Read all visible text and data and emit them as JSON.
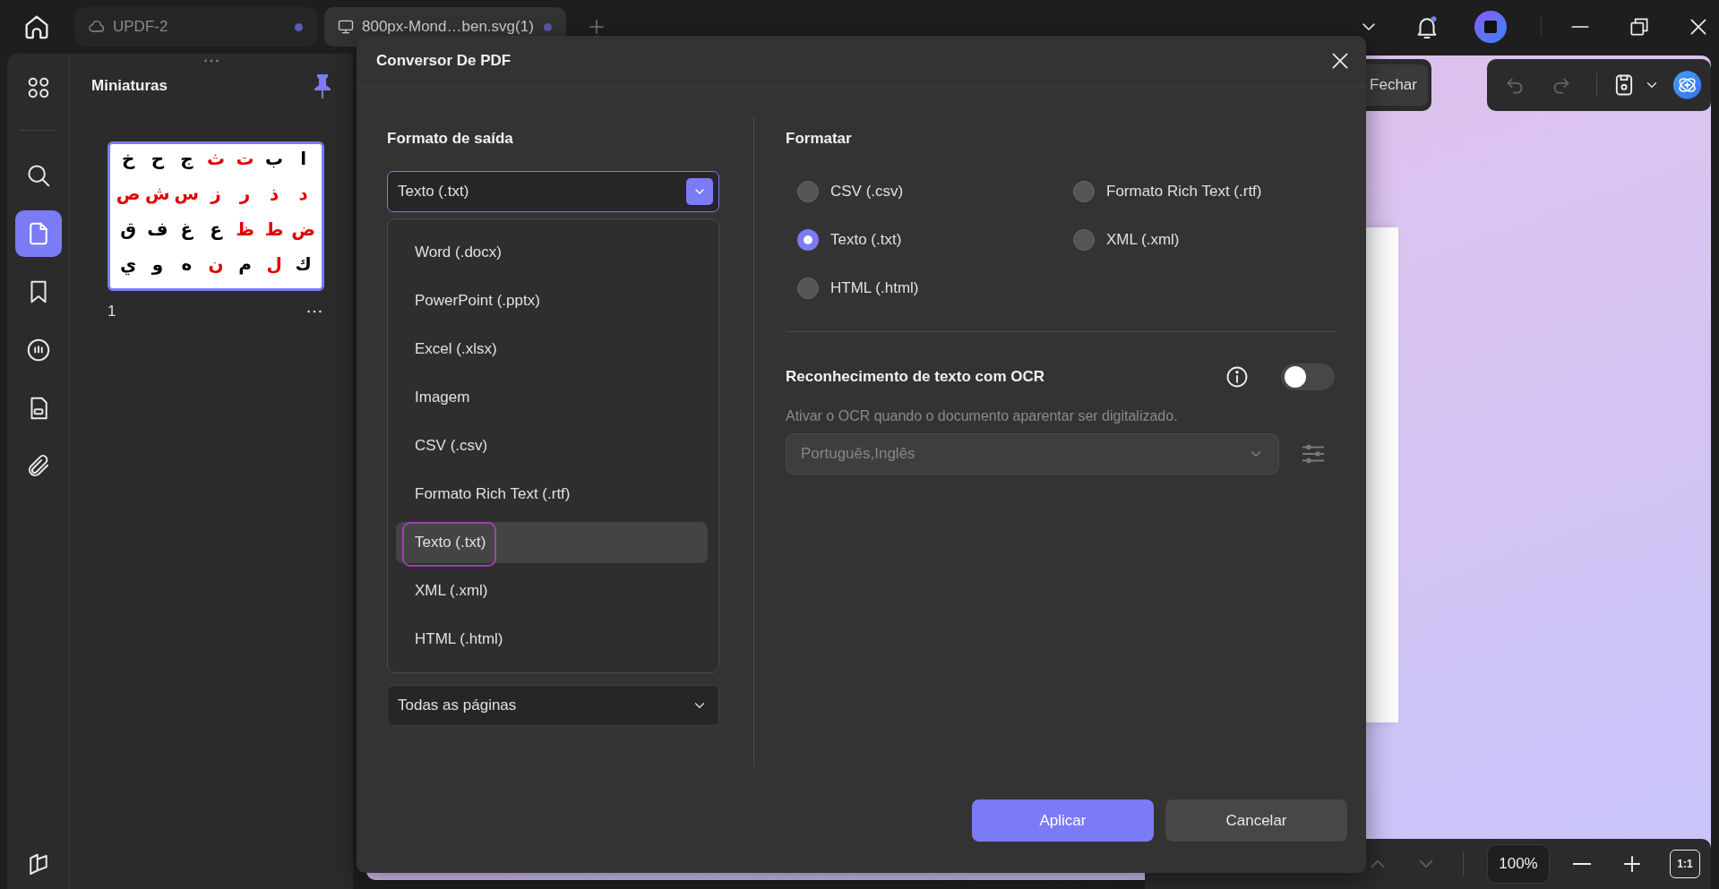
{
  "tabs": [
    {
      "kind": "cloud",
      "label": "UPDF-2",
      "selected": false
    },
    {
      "kind": "local",
      "label": "800px-Mond…ben.svg(1)",
      "selected": true
    }
  ],
  "nav_rail": [
    {
      "kind": "apps",
      "selected": false
    },
    {
      "kind": "search",
      "selected": false
    },
    {
      "kind": "page",
      "selected": true
    },
    {
      "kind": "bookmark",
      "selected": false
    },
    {
      "kind": "comment",
      "selected": false
    },
    {
      "kind": "form",
      "selected": false
    },
    {
      "kind": "attachment",
      "selected": false
    },
    {
      "kind": "pages",
      "selected": false
    }
  ],
  "thumbnails_panel": {
    "title": "Miniaturas",
    "pages": [
      {
        "number": "1",
        "selected": true,
        "rows": [
          [
            {
              "char": "خ",
              "color": "#000000"
            },
            {
              "char": "ح",
              "color": "#000000"
            },
            {
              "char": "ج",
              "color": "#000000"
            },
            {
              "char": "ث",
              "color": "#e00000"
            },
            {
              "char": "ت",
              "color": "#e00000"
            },
            {
              "char": "ب",
              "color": "#000000"
            },
            {
              "char": "ا",
              "color": "#000000"
            }
          ],
          [
            {
              "char": "ص",
              "color": "#e00000"
            },
            {
              "char": "ش",
              "color": "#e00000"
            },
            {
              "char": "س",
              "color": "#e00000"
            },
            {
              "char": "ز",
              "color": "#e00000"
            },
            {
              "char": "ر",
              "color": "#e00000"
            },
            {
              "char": "ذ",
              "color": "#e00000"
            },
            {
              "char": "د",
              "color": "#e00000"
            }
          ],
          [
            {
              "char": "ق",
              "color": "#000000"
            },
            {
              "char": "ف",
              "color": "#000000"
            },
            {
              "char": "غ",
              "color": "#000000"
            },
            {
              "char": "ع",
              "color": "#000000"
            },
            {
              "char": "ظ",
              "color": "#e00000"
            },
            {
              "char": "ط",
              "color": "#e00000"
            },
            {
              "char": "ض",
              "color": "#e00000"
            }
          ],
          [
            {
              "char": "ي",
              "color": "#000000"
            },
            {
              "char": "و",
              "color": "#000000"
            },
            {
              "char": "ه",
              "color": "#000000"
            },
            {
              "char": "ن",
              "color": "#e00000"
            },
            {
              "char": "م",
              "color": "#000000"
            },
            {
              "char": "ل",
              "color": "#e00000"
            },
            {
              "char": "ك",
              "color": "#000000"
            }
          ]
        ]
      }
    ]
  },
  "document": {
    "close_label": "Fechar",
    "zoom": "100%",
    "fit_label": "1:1"
  },
  "dialog": {
    "title": "Conversor De PDF",
    "output_heading": "Formato de saída",
    "output_format": {
      "value": "Texto (.txt)",
      "expanded": true,
      "options": [
        {
          "label": "Word (.docx)",
          "selected": false,
          "outlined": false
        },
        {
          "label": "PowerPoint (.pptx)",
          "selected": false,
          "outlined": false
        },
        {
          "label": "Excel (.xlsx)",
          "selected": false,
          "outlined": false
        },
        {
          "label": "Imagem",
          "selected": false,
          "outlined": false
        },
        {
          "label": "CSV (.csv)",
          "selected": false,
          "outlined": false
        },
        {
          "label": "Formato Rich Text (.rtf)",
          "selected": false,
          "outlined": false
        },
        {
          "label": "Texto (.txt)",
          "selected": true,
          "outlined": true
        },
        {
          "label": "XML (.xml)",
          "selected": false,
          "outlined": false
        },
        {
          "label": "HTML (.html)",
          "selected": false,
          "outlined": false
        }
      ]
    },
    "page_range": {
      "value": "Todas as páginas"
    },
    "format_heading": "Formatar",
    "format_options": [
      {
        "label": "CSV (.csv)",
        "selected": false
      },
      {
        "label": "Formato Rich Text (.rtf)",
        "selected": false
      },
      {
        "label": "Texto (.txt)",
        "selected": true
      },
      {
        "label": "XML (.xml)",
        "selected": false
      },
      {
        "label": "HTML (.html)",
        "selected": false
      }
    ],
    "ocr": {
      "title": "Reconhecimento de texto com OCR",
      "on": false,
      "description": "Ativar o OCR quando o documento aparentar ser digitalizado.",
      "language": {
        "value": "Português,Inglês",
        "disabled": true
      }
    },
    "buttons": [
      {
        "kind": "primary",
        "label": "Aplicar"
      },
      {
        "kind": "secondary",
        "label": "Cancelar"
      }
    ]
  }
}
